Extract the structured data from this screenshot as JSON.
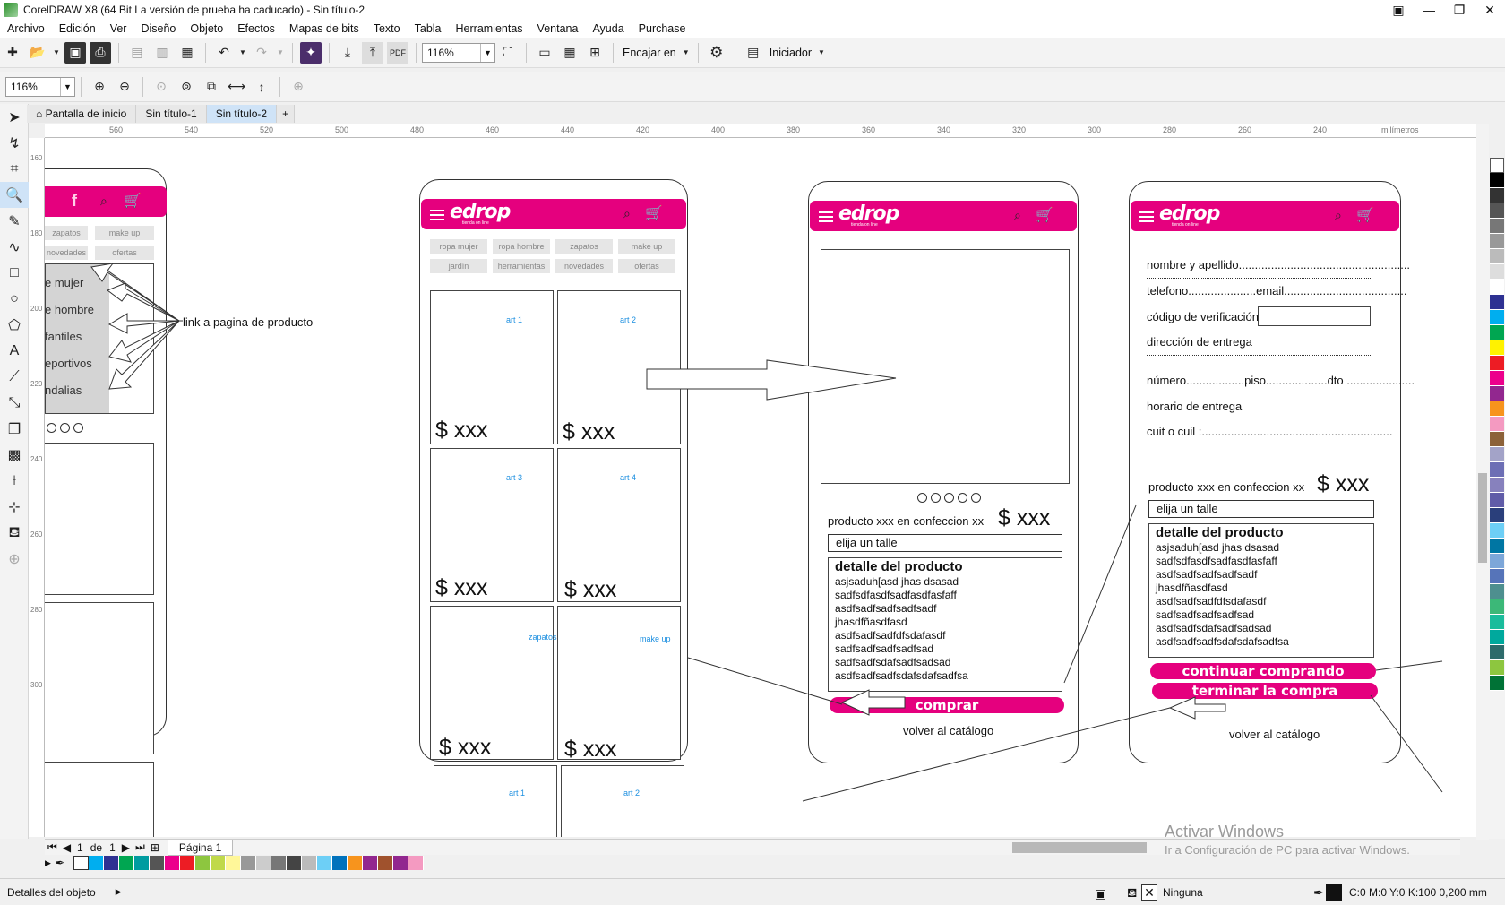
{
  "window": {
    "title": "CorelDRAW X8 (64 Bit La versión de prueba ha caducado) - Sin título-2",
    "controls": [
      "▣",
      "—",
      "❐",
      "✕"
    ]
  },
  "menu": [
    "Archivo",
    "Edición",
    "Ver",
    "Diseño",
    "Objeto",
    "Efectos",
    "Mapas de bits",
    "Texto",
    "Tabla",
    "Herramientas",
    "Ventana",
    "Ayuda",
    "Purchase"
  ],
  "toolbar1": {
    "zoom_value": "116%",
    "snap_label": "Encajar en",
    "launcher_label": "Iniciador"
  },
  "toolbar2": {
    "zoom_value": "116%"
  },
  "tabs": [
    "Pantalla de inicio",
    "Sin título-1",
    "Sin título-2"
  ],
  "ruler": {
    "h_ticks": [
      "560",
      "540",
      "520",
      "500",
      "480",
      "460",
      "440",
      "420",
      "400",
      "380",
      "360",
      "340",
      "320",
      "300",
      "280",
      "260",
      "240"
    ],
    "unit": "milímetros",
    "v_ticks": [
      "160",
      "180",
      "200",
      "220",
      "240",
      "260",
      "280",
      "300"
    ]
  },
  "page_nav": {
    "current": "1",
    "of_label": "de",
    "total": "1",
    "page_tab": "Página 1"
  },
  "status": {
    "object_details": "Detalles del objeto",
    "fill_none": "Ninguna",
    "color_info": "C:0 M:0 Y:0 K:100  0,200 mm"
  },
  "watermark": {
    "line1": "Activar Windows",
    "line2": "Ir a Configuración de PC para activar Windows."
  },
  "mockup_left": {
    "chips": [
      "zapatos",
      "make up",
      "novedades",
      "ofertas"
    ],
    "menu_items": [
      "e mujer",
      "e hombre",
      "fantiles",
      "eportivos",
      "ndalias"
    ],
    "annotation": "link a pagina de producto"
  },
  "mockup_catalog": {
    "logo": "edrop",
    "logo_sub": "tienda on line",
    "chips": [
      "ropa mujer",
      "ropa hombre",
      "zapatos",
      "make up",
      "jardín",
      "herramientas",
      "novedades",
      "ofertas"
    ],
    "cards": [
      {
        "label": "art 1",
        "price": "$ xxx"
      },
      {
        "label": "art 2",
        "price": "$ xxx"
      },
      {
        "label": "art 3",
        "price": "$ xxx"
      },
      {
        "label": "art 4",
        "price": "$ xxx"
      },
      {
        "label": "zapatos",
        "price": "$ xxx"
      },
      {
        "label": "make up",
        "price": "$ xxx"
      },
      {
        "label": "art 1",
        "price": ""
      },
      {
        "label": "art 2",
        "price": ""
      }
    ]
  },
  "mockup_product": {
    "logo": "edrop",
    "logo_sub": "tienda on line",
    "product_line": "producto xxx en confeccion xx",
    "price": "$ xxx",
    "size_field": "elija un talle",
    "detail_title": "detalle del producto",
    "detail_lines": [
      "asjsaduh[asd jhas dsasad",
      "sadfsdfasdfsadfasdfasfaff",
      "asdfsadfsadfsadfsadf",
      "jhasdfñasdfasd",
      "asdfsadfsadfdfsdafasdf",
      "sadfsadfsadfsadfsad",
      "sadfsadfsdafsadfsadsad",
      "asdfsadfsadfsdafsdafsadfsa"
    ],
    "buy_button": "comprar",
    "back_link": "volver al catálogo"
  },
  "mockup_checkout": {
    "logo": "edrop",
    "logo_sub": "tienda on line",
    "fields": [
      "nombre y apellido.....................................................",
      "telefono.....................email......................................",
      "código de verificación",
      "dirección de entrega",
      "número..................piso...................dto .....................",
      "horario de entrega",
      "cuit o cuil :..........................................................."
    ],
    "product_line": "producto xxx en confeccion xx",
    "price": "$ xxx",
    "size_field": "elija un talle",
    "detail_title": "detalle del producto",
    "detail_lines": [
      "asjsaduh[asd jhas dsasad",
      "sadfsdfasdfsadfasdfasfaff",
      "asdfsadfsadfsadfsadf",
      "jhasdfñasdfasd",
      "asdfsadfsadfdfsdafasdf",
      "sadfsadfsadfsadfsad",
      "asdfsadfsdafsadfsadsad",
      "asdfsadfsadfsdafsdafsadfsa"
    ],
    "continue_button": "continuar comprando",
    "finish_button": "terminar la compra",
    "back_link": "volver al catálogo"
  },
  "colors": {
    "brand_pink": "#e5007e",
    "link_blue": "#1c8fe0"
  }
}
